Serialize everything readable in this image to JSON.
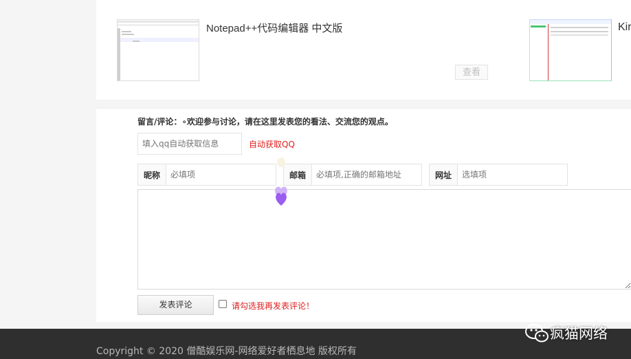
{
  "articles": [
    {
      "title": "Notepad++代码编辑器 中文版",
      "view_label": "查看"
    },
    {
      "title": "Kir"
    }
  ],
  "comment_form": {
    "prompt": "留言/评论：∘欢迎参与讨论，请在这里发表您的看法、交流您的观点。",
    "qq_placeholder": "填入qq自动获取信息",
    "qq_link": "自动获取QQ",
    "fields": [
      {
        "label": "昵称",
        "placeholder": "必填项"
      },
      {
        "label": "邮箱",
        "placeholder": "必填项,正确的邮箱地址"
      },
      {
        "label": "网址",
        "placeholder": "选填项"
      }
    ],
    "submit_label": "发表评论",
    "agree_text": "请勾选我再发表评论！",
    "agree_checked": false
  },
  "footer": {
    "copyright": "Copyright © 2020 僧酷娱乐网-网络爱好者栖息地 版权所有"
  },
  "watermark": {
    "text": "疯猫网络"
  },
  "colors": {
    "accent_red": "#e02020",
    "footer_bg": "#2f2f2f",
    "heart": "#9b5cf0"
  }
}
